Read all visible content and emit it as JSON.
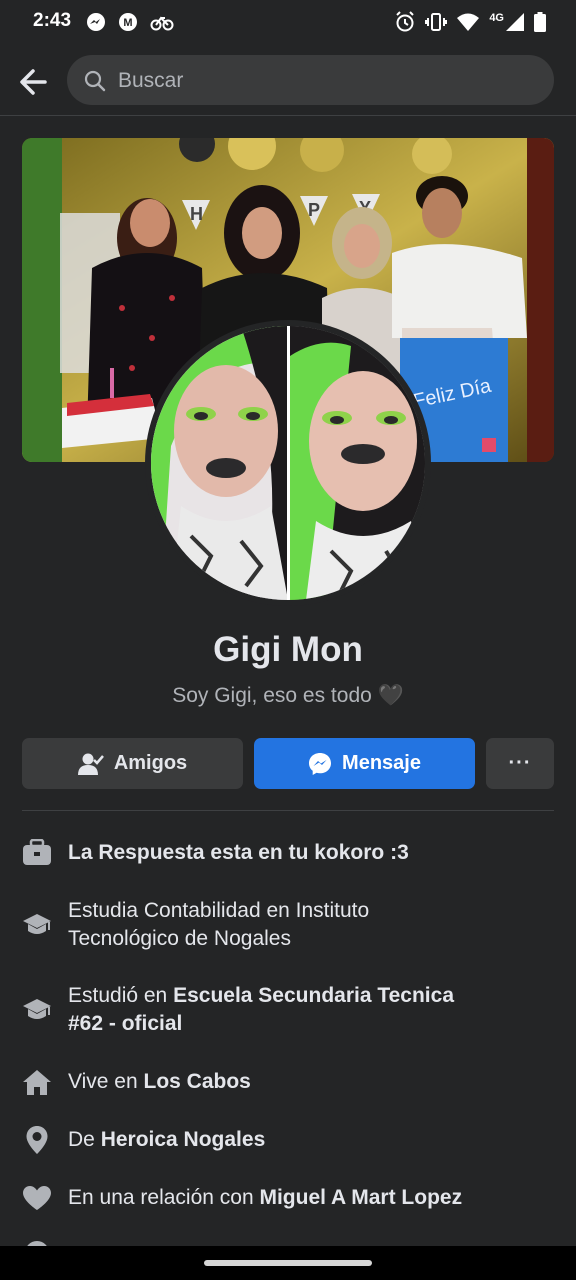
{
  "status_bar": {
    "time": "2:43",
    "network": "4G",
    "left_icons": [
      "messenger-icon",
      "mail-icon",
      "bike-icon"
    ],
    "right_icons": [
      "alarm-icon",
      "vibrate-icon",
      "wifi-icon",
      "signal-icon",
      "battery-icon"
    ]
  },
  "search": {
    "placeholder": "Buscar"
  },
  "profile": {
    "name": "Gigi Mon",
    "bio": "Soy Gigi, eso es todo 🖤"
  },
  "cover_photo": {
    "banner_letters": [
      "H",
      "P",
      "Y"
    ],
    "bag_text": "Feliz Día"
  },
  "buttons": {
    "friends_label": "Amigos",
    "message_label": "Mensaje",
    "more_label": "···"
  },
  "info": {
    "work": "La Respuesta esta en tu kokoro :3",
    "studies_line1": "Estudia Contabilidad en Instituto",
    "studies_line2": "Tecnológico de Nogales",
    "studied_prefix": "Estudió en ",
    "studied_school_line1": "Escuela Secundaria Tecnica",
    "studied_school_line2": "#62 - oficial",
    "lives_prefix": "Vive en ",
    "lives_city": "Los Cabos",
    "from_prefix": "De ",
    "from_city": "Heroica Nogales",
    "relationship_prefix": "En una relación con ",
    "relationship_partner": "Miguel A Mart Lopez"
  },
  "colors": {
    "background": "#242526",
    "surface": "#3a3b3c",
    "accent": "#2374e1",
    "text_primary": "#e4e6eb",
    "text_secondary": "#b0b3b8"
  }
}
